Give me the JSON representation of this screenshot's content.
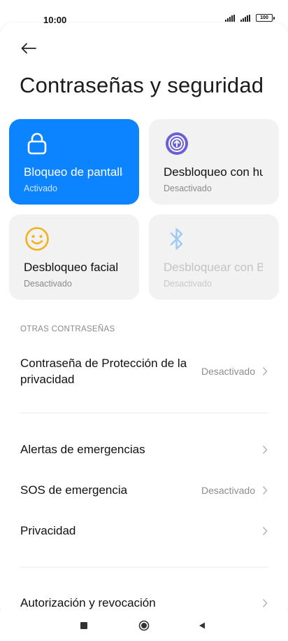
{
  "status_bar": {
    "time": "10:00",
    "battery": "100"
  },
  "header": {
    "title": "Contraseñas y seguridad"
  },
  "tiles": [
    {
      "title": "Bloqueo de pantalla",
      "status": "Activado",
      "icon": "lock-icon",
      "state": "active",
      "accent": "#0d84ff"
    },
    {
      "title": "Desbloqueo con huella",
      "status": "Desactivado",
      "icon": "fingerprint-icon",
      "state": "normal",
      "accent": "#6b5fd3"
    },
    {
      "title": "Desbloqueo facial",
      "status": "Desactivado",
      "icon": "face-icon",
      "state": "normal",
      "accent": "#f2b21d"
    },
    {
      "title": "Desbloquear con Bluetooth",
      "status": "Desactivado",
      "icon": "bluetooth-icon",
      "state": "disabled",
      "accent": "#9ccaf5"
    }
  ],
  "section": {
    "other_passwords": "OTRAS CONTRASEÑAS"
  },
  "rows": {
    "privacy_protection": {
      "label": "Contraseña de Protección de la privacidad",
      "value": "Desactivado"
    },
    "emergency_alerts": {
      "label": "Alertas de emergencias",
      "value": ""
    },
    "emergency_sos": {
      "label": "SOS de emergencia",
      "value": "Desactivado"
    },
    "privacy": {
      "label": "Privacidad",
      "value": ""
    },
    "authorization": {
      "label": "Autorización y revocación",
      "value": ""
    }
  }
}
